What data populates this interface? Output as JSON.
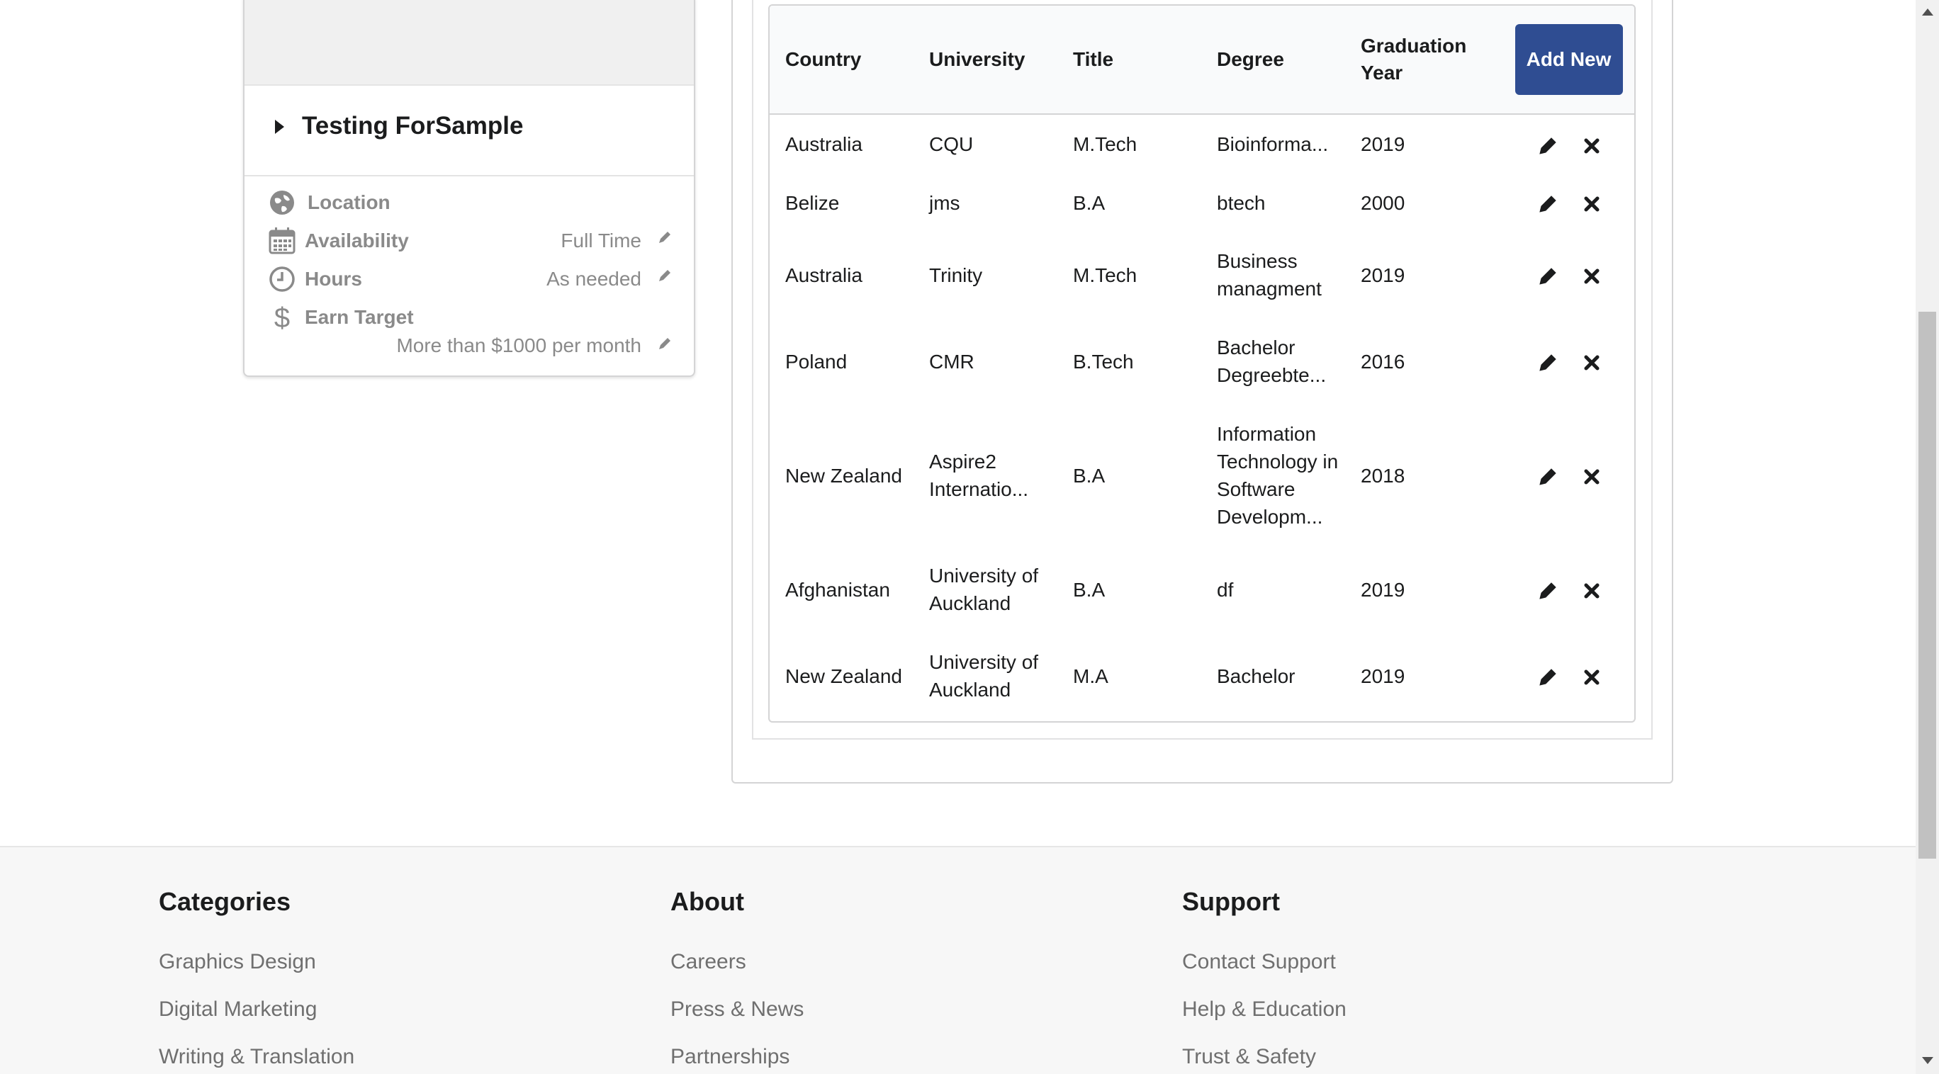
{
  "profile": {
    "name": "Testing ForSample",
    "rows": [
      {
        "icon": "globe-icon",
        "label": "Location",
        "value": "",
        "editable": false
      },
      {
        "icon": "calendar-icon",
        "label": "Availability",
        "value": "Full Time",
        "editable": true
      },
      {
        "icon": "clock-icon",
        "label": "Hours",
        "value": "As needed",
        "editable": true
      },
      {
        "icon": "dollar-icon",
        "label": "Earn Target",
        "value": "More than $1000 per month",
        "editable": true
      }
    ]
  },
  "education": {
    "columns": {
      "country": "Country",
      "university": "University",
      "title": "Title",
      "degree": "Degree",
      "graduation_year": "Graduation Year"
    },
    "add_button_label": "Add New",
    "rows": [
      {
        "country": "Australia",
        "university": "CQU",
        "title": "M.Tech",
        "degree": "Bioinforma...",
        "year": "2019"
      },
      {
        "country": "Belize",
        "university": "jms",
        "title": "B.A",
        "degree": "btech",
        "year": "2000"
      },
      {
        "country": "Australia",
        "university": "Trinity",
        "title": "M.Tech",
        "degree": "Business managment",
        "year": "2019"
      },
      {
        "country": "Poland",
        "university": "CMR",
        "title": "B.Tech",
        "degree": "Bachelor Degreebte...",
        "year": "2016"
      },
      {
        "country": "New Zealand",
        "university": "Aspire2 Internatio...",
        "title": "B.A",
        "degree": "Information Technology in Software Developm...",
        "year": "2018"
      },
      {
        "country": "Afghanistan",
        "university": "University of Auckland",
        "title": "B.A",
        "degree": "df",
        "year": "2019"
      },
      {
        "country": "New Zealand",
        "university": "University of Auckland",
        "title": "M.A",
        "degree": "Bachelor",
        "year": "2019"
      }
    ],
    "row_actions": {
      "edit_icon": "pencil-icon",
      "delete_icon": "close-icon"
    }
  },
  "footer": {
    "columns": [
      {
        "heading": "Categories",
        "links": [
          "Graphics Design",
          "Digital Marketing",
          "Writing & Translation"
        ]
      },
      {
        "heading": "About",
        "links": [
          "Careers",
          "Press & News",
          "Partnerships"
        ]
      },
      {
        "heading": "Support",
        "links": [
          "Contact Support",
          "Help & Education",
          "Trust & Safety"
        ]
      }
    ]
  },
  "colors": {
    "primary_button": "#2f4d92",
    "muted_text": "#8a8a8a",
    "footer_bg": "#f7f7f7"
  }
}
